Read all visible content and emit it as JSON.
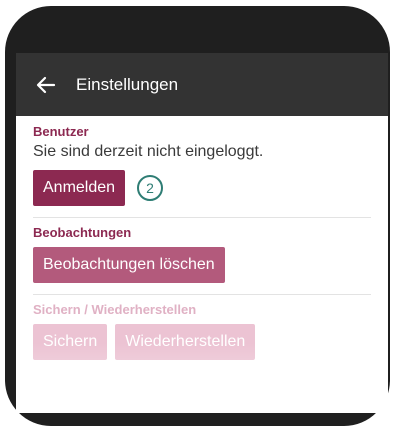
{
  "appbar": {
    "title": "Einstellungen",
    "back_icon": "arrow-left-icon"
  },
  "sections": {
    "user": {
      "title": "Benutzer",
      "status": "Sie sind derzeit nicht eingeloggt.",
      "login_label": "Anmelden",
      "step_badge": "2"
    },
    "observations": {
      "title": "Beobachtungen",
      "delete_label": "Beobachtungen löschen"
    },
    "backup": {
      "title": "Sichern / Wiederherstellen",
      "save_label": "Sichern",
      "restore_label": "Wiederherstellen"
    }
  },
  "colors": {
    "accent": "#8c2951",
    "appbar": "#333333",
    "badge": "#2e7d74"
  }
}
